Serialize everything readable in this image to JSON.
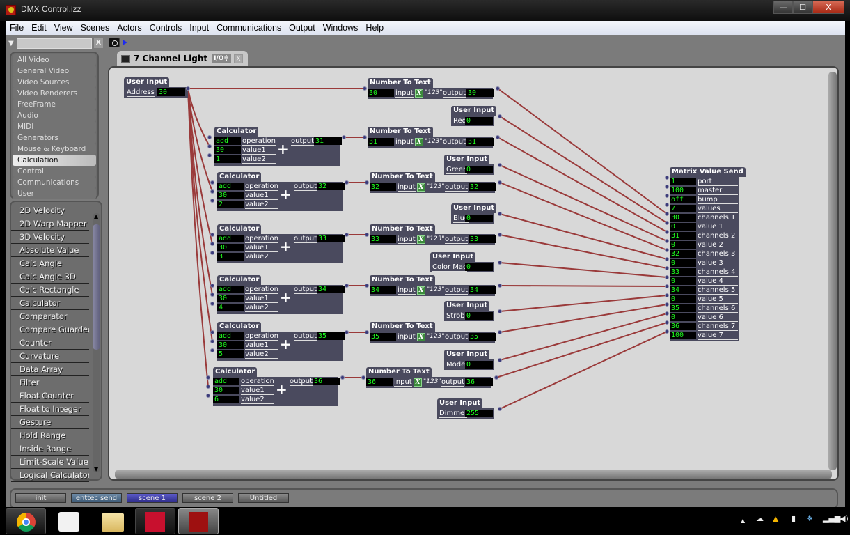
{
  "window": {
    "title": "DMX Control.izz",
    "controls": {
      "minimize": "—",
      "maximize": "☐",
      "close": "X"
    }
  },
  "menu": [
    "File",
    "Edit",
    "View",
    "Scenes",
    "Actors",
    "Controls",
    "Input",
    "Communications",
    "Output",
    "Windows",
    "Help"
  ],
  "filter": {
    "value": "",
    "clear": "X"
  },
  "categories": {
    "items": [
      "All Video",
      "General Video",
      "Video Sources",
      "Video Renderers",
      "FreeFrame",
      "Audio",
      "MIDI",
      "Generators",
      "Mouse & Keyboard",
      "Calculation",
      "Control",
      "Communications",
      "User"
    ],
    "selected": "Calculation"
  },
  "actors": [
    "2D Velocity",
    "2D Warp Mapper",
    "3D Velocity",
    "Absolute Value",
    "Calc Angle",
    "Calc Angle 3D",
    "Calc Rectangle",
    "Calculator",
    "Comparator",
    "Compare Guarded",
    "Counter",
    "Curvature",
    "Data Array",
    "Filter",
    "Float Counter",
    "Float to Integer",
    "Gesture",
    "Hold Range",
    "Inside Range",
    "Limit-Scale Value",
    "Logical Calculator"
  ],
  "tab": {
    "label": "7 Channel Light",
    "io": "I/O≑",
    "close": "X"
  },
  "nodes": {
    "address": {
      "title": "User Input",
      "label": "Address",
      "value": "30"
    },
    "calculators": [
      {
        "title": "Calculator",
        "operation": "add",
        "value1": "30",
        "value2": "1",
        "output": "31"
      },
      {
        "title": "Calculator",
        "operation": "add",
        "value1": "30",
        "value2": "2",
        "output": "32"
      },
      {
        "title": "Calculator",
        "operation": "add",
        "value1": "30",
        "value2": "3",
        "output": "33"
      },
      {
        "title": "Calculator",
        "operation": "add",
        "value1": "30",
        "value2": "4",
        "output": "34"
      },
      {
        "title": "Calculator",
        "operation": "add",
        "value1": "30",
        "value2": "5",
        "output": "35"
      },
      {
        "title": "Calculator",
        "operation": "add",
        "value1": "30",
        "value2": "6",
        "output": "36"
      }
    ],
    "calc_labels": {
      "operation": "operation",
      "value1": "value1",
      "value2": "value2",
      "output": "output",
      "plus": "+"
    },
    "ntt": [
      {
        "title": "Number To Text",
        "input": "30",
        "output": "30"
      },
      {
        "title": "Number To Text",
        "input": "31",
        "output": "31"
      },
      {
        "title": "Number To Text",
        "input": "32",
        "output": "32"
      },
      {
        "title": "Number To Text",
        "input": "33",
        "output": "33"
      },
      {
        "title": "Number To Text",
        "input": "34",
        "output": "34"
      },
      {
        "title": "Number To Text",
        "input": "35",
        "output": "35"
      },
      {
        "title": "Number To Text",
        "input": "36",
        "output": "36"
      }
    ],
    "ntt_labels": {
      "input": "input",
      "output": "output",
      "x": "X",
      "fmt": "\"123\""
    },
    "user_inputs": [
      {
        "title": "User Input",
        "label": "Red",
        "value": "0"
      },
      {
        "title": "User Input",
        "label": "Green",
        "value": "0"
      },
      {
        "title": "User Input",
        "label": "Blue",
        "value": "0"
      },
      {
        "title": "User Input",
        "label": "Color Mac",
        "value": "0"
      },
      {
        "title": "User Input",
        "label": "Strobe",
        "value": "0"
      },
      {
        "title": "User Input",
        "label": "Mode",
        "value": "0"
      },
      {
        "title": "User Input",
        "label": "Dimmer",
        "value": "255"
      }
    ],
    "matrix": {
      "title": "Matrix Value Send",
      "rows": [
        {
          "value": "1",
          "label": "port"
        },
        {
          "value": "100",
          "label": "master"
        },
        {
          "value": "off",
          "label": "bump"
        },
        {
          "value": "7",
          "label": "values"
        },
        {
          "value": "30",
          "label": "channels 1"
        },
        {
          "value": "0",
          "label": "value 1"
        },
        {
          "value": "31",
          "label": "channels 2"
        },
        {
          "value": "0",
          "label": "value 2"
        },
        {
          "value": "32",
          "label": "channels 3"
        },
        {
          "value": "0",
          "label": "value 3"
        },
        {
          "value": "33",
          "label": "channels 4"
        },
        {
          "value": "0",
          "label": "value 4"
        },
        {
          "value": "34",
          "label": "channels 5"
        },
        {
          "value": "0",
          "label": "value 5"
        },
        {
          "value": "35",
          "label": "channels 6"
        },
        {
          "value": "0",
          "label": "value 6"
        },
        {
          "value": "36",
          "label": "channels 7"
        },
        {
          "value": "100",
          "label": "value 7"
        }
      ]
    }
  },
  "scenes": [
    {
      "label": "init",
      "state": "normal"
    },
    {
      "label": "enttec send",
      "state": "active"
    },
    {
      "label": "scene 1",
      "state": "selected"
    },
    {
      "label": "scene 2",
      "state": "normal"
    },
    {
      "label": "Untitled",
      "state": "normal"
    }
  ],
  "taskbar": [
    "chrome",
    "apps",
    "file-explorer",
    "acrobat",
    "isadora"
  ],
  "tray": [
    "show-hidden-icons",
    "onedrive",
    "google-drive",
    "power",
    "dropbox",
    "signal",
    "volume"
  ],
  "colors": {
    "wire": "#9a3a3a",
    "field_text": "#1eff1e",
    "node_bg": "#4a4a5e",
    "scene_selected": "#3b3aa0",
    "scene_active": "#4d6a86"
  }
}
